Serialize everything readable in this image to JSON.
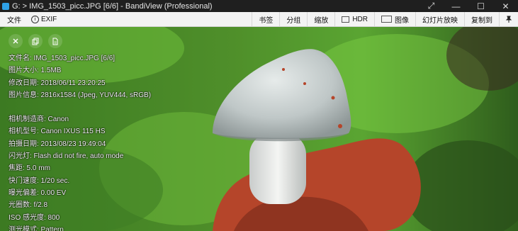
{
  "window": {
    "title": "G: > IMG_1503_picc.JPG [6/6] - BandiView (Professional)",
    "controls": [
      "⤢",
      "—",
      "☐",
      "✕"
    ]
  },
  "menu": {
    "file": "文件",
    "exif": "EXIF",
    "bookmark": "书签",
    "group": "分组",
    "zoom": "缩放",
    "hdr": "HDR",
    "image": "图像",
    "slideshow": "幻灯片放映",
    "copy_to": "复制到"
  },
  "overlay_icons": [
    "close-icon",
    "copy-icon",
    "document-icon"
  ],
  "file_info": [
    "文件名: IMG_1503_picc.JPG [6/6]",
    "图片大小: 1.5MB",
    "修改日期: 2018/06/11 23:20:25",
    "图片信息: 2816x1584 (Jpeg, YUV444, sRGB)"
  ],
  "exif_info": [
    "相机制造商: Canon",
    "相机型号: Canon IXUS 115 HS",
    "拍摄日期: 2013/08/23 19:49:04",
    "闪光灯: Flash did not fire, auto mode",
    "焦距: 5.0 mm",
    "快门速度: 1/20 sec.",
    "曝光偏差: 0.00 EV",
    "光圈数: f/2.8",
    "ISO 感光度: 800",
    "测光模式: Pattern"
  ],
  "colors": {
    "titlebar_bg": "#1f1f1f",
    "menubar_bg": "#f3f3f3",
    "moss": "#6fbf3a",
    "soil": "#b5452a",
    "cap": "#c9cfd0"
  }
}
